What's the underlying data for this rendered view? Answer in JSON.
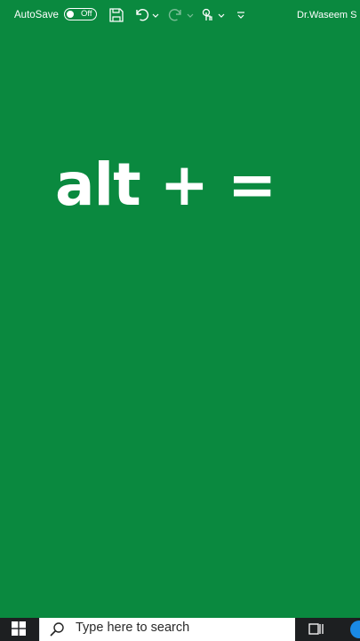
{
  "titlebar": {
    "autosave_label": "AutoSave",
    "autosave_state": "Off",
    "user_name": "Dr.Waseem S",
    "icons": [
      "save-icon",
      "undo-icon",
      "undo-dropdown-icon",
      "redo-icon",
      "redo-dropdown-icon",
      "touch-mode-icon",
      "touch-dropdown-icon",
      "customize-toolbar-icon"
    ]
  },
  "main": {
    "shortcut_text": "alt + ="
  },
  "taskbar": {
    "search_placeholder": "Type here to search",
    "icons": [
      "windows-start-icon",
      "search-icon",
      "task-view-icon",
      "edge-icon"
    ]
  },
  "colors": {
    "background": "#0a893f",
    "text": "#ffffff",
    "taskbar_dark": "#1d1f21",
    "taskbar_light": "#e3e6e8"
  }
}
